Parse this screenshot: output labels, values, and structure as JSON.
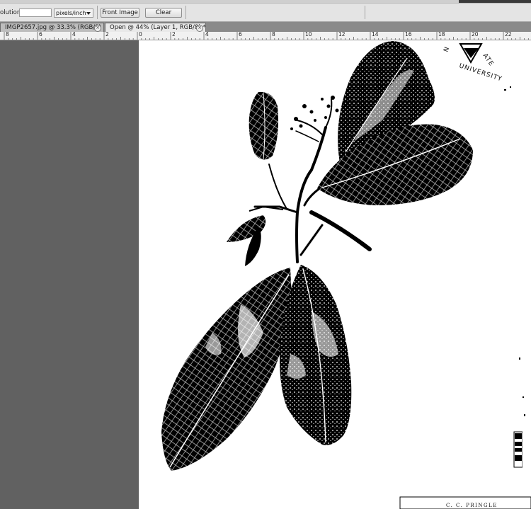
{
  "options_bar": {
    "resolution_label": "olution:",
    "resolution_value": "",
    "units_selected": "pixels/inch",
    "front_image_label": "Front Image",
    "clear_label": "Clear"
  },
  "tabs": [
    {
      "label": "IMGP2657.jpg @ 33.3% (RGB/8)",
      "active": false
    },
    {
      "label": "Open @ 44% (Layer 1, RGB/8) *",
      "active": true
    }
  ],
  "ruler": {
    "labels": [
      "8",
      "6",
      "4",
      "2",
      "0",
      "2",
      "4",
      "6",
      "8",
      "10",
      "12",
      "14",
      "16",
      "18",
      "20",
      "22"
    ]
  },
  "specimen": {
    "seal_text": "ATE",
    "seal_text_2": "UNIVERSITY",
    "seal_text_3": "N",
    "label_line": "C. C. PRINGLE"
  },
  "colors": {
    "workspace": "#616161",
    "options_bar": "#e4e4e4",
    "tab_active": "#e9e9e9",
    "tab_inactive": "#bdbdbd",
    "canvas": "#ffffff"
  }
}
